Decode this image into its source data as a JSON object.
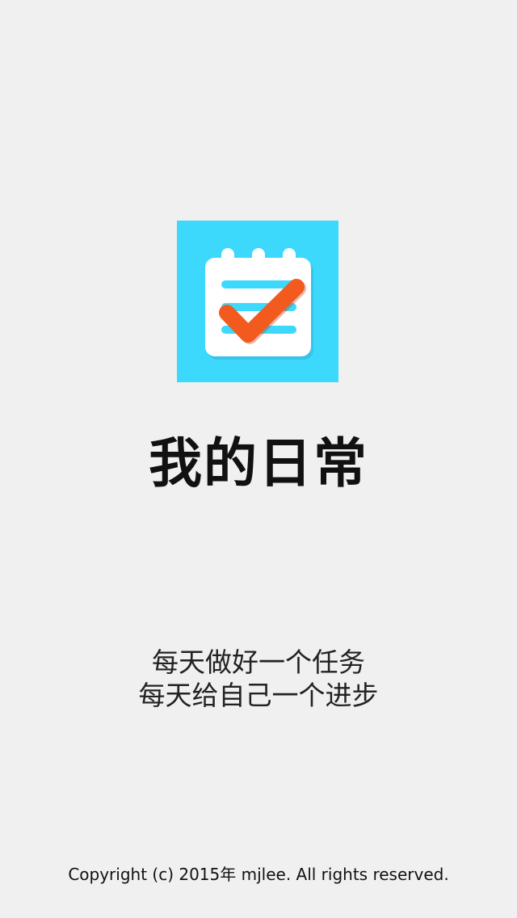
{
  "app": {
    "icon": "calendar-checklist-icon",
    "title": "我的日常"
  },
  "slogan": {
    "line1": "每天做好一个任务",
    "line2": "每天给自己一个进步"
  },
  "footer": {
    "copyright": "Copyright (c) 2015年 mjlee. All rights reserved."
  },
  "colors": {
    "background": "#f0f0f0",
    "icon_background": "#3dd9fd",
    "checkmark": "#f25a1e",
    "notepad": "#ffffff"
  }
}
